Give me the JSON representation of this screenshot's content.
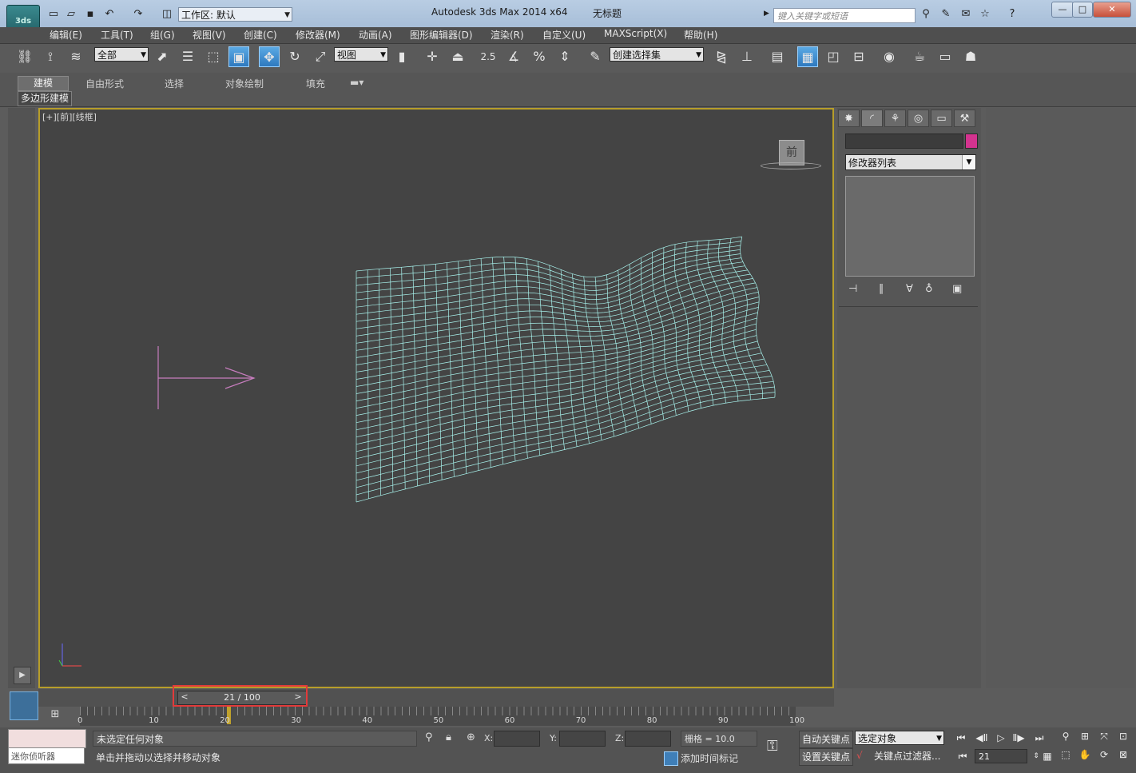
{
  "app": {
    "logo": "3ds",
    "title": "Autodesk 3ds Max  2014 x64",
    "document": "无标题",
    "workspace_label": "工作区: 默认",
    "search_placeholder": "键入关键字或短语"
  },
  "menu": [
    "编辑(E)",
    "工具(T)",
    "组(G)",
    "视图(V)",
    "创建(C)",
    "修改器(M)",
    "动画(A)",
    "图形编辑器(D)",
    "渲染(R)",
    "自定义(U)",
    "MAXScript(X)",
    "帮助(H)"
  ],
  "toolbar": {
    "selection_filter": "全部",
    "ref_coord": "视图",
    "named_selection": "创建选择集",
    "snap_25": "2.5",
    "percent": "%"
  },
  "ribbon": {
    "tabs": [
      "建模",
      "自由形式",
      "选择",
      "对象绘制",
      "填充"
    ],
    "active_tab": "建模",
    "panel": "多边形建模"
  },
  "viewport": {
    "label": "[+][前][线框]",
    "viewcube_face": "前",
    "wire_color": "#a8f2ec",
    "border_color": "#b79e2a"
  },
  "command_panel": {
    "modifier_list": "修改器列表",
    "color": "#d4338f"
  },
  "timeline": {
    "frame_display": "21 / 100",
    "prev": "<",
    "next": ">",
    "current_frame": 21,
    "total_frames": 100,
    "ticks": [
      "0",
      "10",
      "20",
      "30",
      "40",
      "50",
      "60",
      "70",
      "80",
      "90",
      "100"
    ]
  },
  "status": {
    "listener_label": "迷你侦听器",
    "selection_text": "未选定任何对象",
    "prompt_text": "单击并拖动以选择并移动对象",
    "x_label": "X:",
    "y_label": "Y:",
    "z_label": "Z:",
    "grid": "栅格 = 10.0",
    "add_time_tag": "添加时间标记",
    "auto_key": "自动关键点",
    "set_key": "设置关键点",
    "key_mode": "选定对象",
    "key_filters": "关键点过滤器...",
    "frame_field": "21"
  }
}
